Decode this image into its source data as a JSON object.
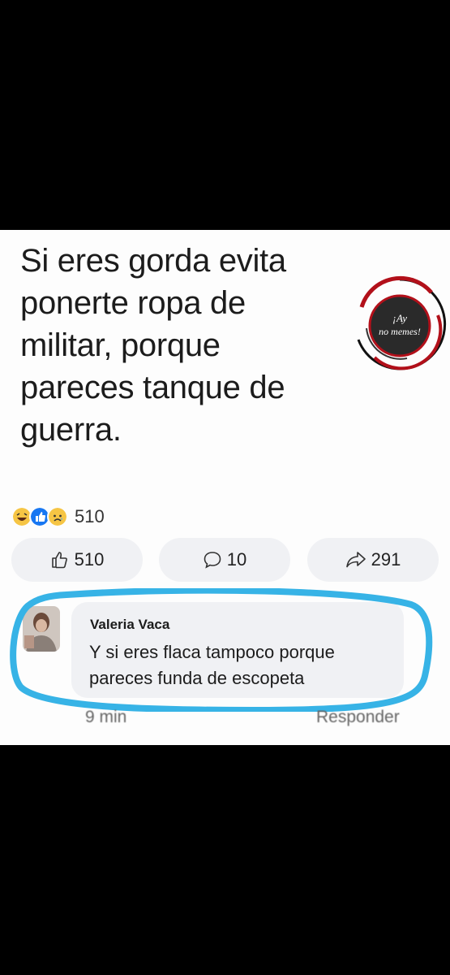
{
  "post": {
    "text": "Si eres gorda evita\nponerte ropa de\nmilitar, porque\npareces tanque de\nguerra."
  },
  "logo": {
    "line1": "¡Ay",
    "line2": "no memes!"
  },
  "reactions": {
    "icons": [
      "haha-icon",
      "like-icon",
      "sad-icon"
    ],
    "count": "510"
  },
  "actions": {
    "like_count": "510",
    "comment_count": "10",
    "share_count": "291"
  },
  "comment": {
    "author": "Valeria Vaca",
    "text": "Y si eres flaca tampoco porque\npareces funda de escopeta",
    "time": "9 min",
    "reply": "Responder"
  },
  "colors": {
    "highlight": "#37b3e6",
    "logo_ring": "#b2101a",
    "like": "#1877f2",
    "haha": "#f6c544"
  }
}
